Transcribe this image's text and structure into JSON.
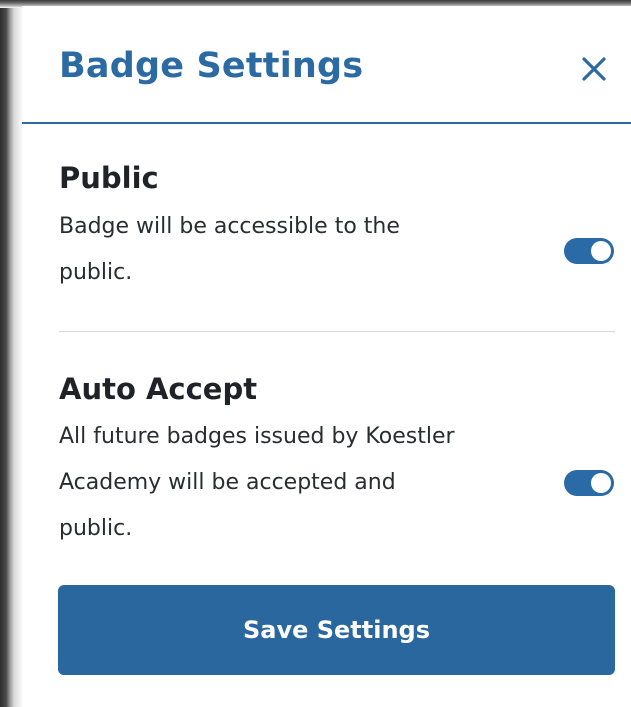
{
  "dialog": {
    "title": "Badge Settings",
    "close_icon": "close-icon"
  },
  "settings": [
    {
      "title": "Public",
      "description_line1": "Badge will be accessible to the",
      "description_line2": "public.",
      "enabled": true
    },
    {
      "title": "Auto Accept",
      "description_line1": "All future badges issued by Koestler",
      "description_line2": "Academy will be accepted and",
      "description_line3": "public.",
      "enabled": true
    }
  ],
  "actions": {
    "save_label": "Save Settings"
  },
  "colors": {
    "accent": "#2b6aa3",
    "button": "#2b679f",
    "toggle_on": "#2a6aa6"
  }
}
